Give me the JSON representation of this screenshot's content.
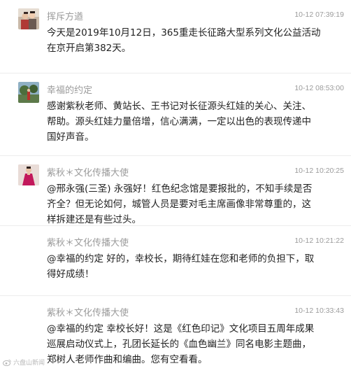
{
  "comments": [
    {
      "username": "挥斥方遒",
      "time": "10-12 07:39:19",
      "avatar": "photo-avatar-two-people",
      "lines": [
        "今天是2019年10月12日，365重走长征路大型系列文化公益活动",
        "在京开启第382天。"
      ]
    },
    {
      "username": "幸福的约定",
      "time": "10-12 08:53:00",
      "avatar": "photo-avatar-tree-scene",
      "lines": [
        "感谢紫秋老师、黄站长、王书记对长征源头红娃的关心、关注、",
        "帮助。源头红娃力量倍增，信心满满，一定以出色的表现传递中",
        "国好声音。"
      ]
    },
    {
      "username": "紫秋＊文化传播大使",
      "time": "10-12 10:20:25",
      "avatar": "photo-avatar-woman-red-dress",
      "lines": [
        "@邢永强(三圣) 永强好！红色纪念馆是要报批的，不知手续是否",
        "齐全？但无论如何，城管人员是要对毛主席画像非常尊重的，这",
        "样拆建还是有些过头。"
      ]
    },
    {
      "username": "紫秋＊文化传播大使",
      "time": "10-12 10:21:22",
      "avatar": "",
      "lines": [
        "@幸福的约定 好的，幸校长，期待红娃在您和老师的负担下，取",
        "得好成绩！"
      ]
    },
    {
      "username": "紫秋＊文化传播大使",
      "time": "10-12 10:33:43",
      "avatar": "",
      "lines": [
        "@幸福的约定 幸校长好！这是《红色印记》文化项目五周年成果",
        "巡展启动仪式上，孔团长延长的《血色幽兰》同名电影主题曲，",
        "郑树人老师作曲和编曲。您有空看看。"
      ]
    }
  ],
  "watermark": {
    "icon": "weibo-logo-icon",
    "text": "六盘山新闻"
  }
}
